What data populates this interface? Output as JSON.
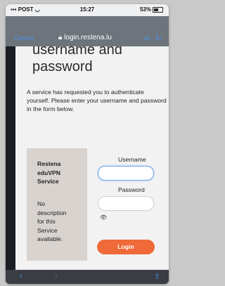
{
  "status_bar": {
    "carrier": "POST",
    "time": "15:27",
    "battery": "53%",
    "battery_level": 0.53
  },
  "browser": {
    "cancel_label": "Cancel",
    "url": "login.restena.lu",
    "text_size_label": "aA"
  },
  "page": {
    "heading_line1": "username and",
    "heading_line2": "password",
    "intro": "A service has requested you to authenticate yourself. Please enter your username and password in the form below.",
    "service_name_lines": [
      "Restena",
      "eduVPN",
      "Service"
    ],
    "service_desc_lines": [
      "No",
      "description",
      "for this",
      "Service",
      "available."
    ],
    "username_label": "Username",
    "username_value": "",
    "password_label": "Password",
    "password_value": "",
    "login_label": "Login"
  },
  "icons": [
    "wifi-icon",
    "lock-icon",
    "reload-icon",
    "eye-icon",
    "back-icon",
    "forward-icon",
    "share-icon"
  ],
  "colors": {
    "login_button": "#ef6a38",
    "browser_blue": "#4a8fe8",
    "service_panel": "#d8d3cf"
  }
}
